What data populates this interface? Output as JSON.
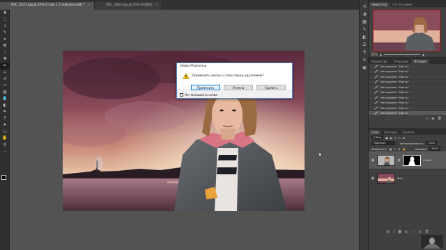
{
  "tabs": [
    {
      "label": "DSC_5227.jpg @ 25% (Слой 1, Слой-маска/8) *",
      "active": true
    },
    {
      "label": "DSC_1853.jpg @ 25% (RGB/8)",
      "active": false
    }
  ],
  "dialog": {
    "title": "Adobe Photoshop",
    "message": "Применить маску к слою перед удалением?",
    "buttons": {
      "apply": "Применить",
      "cancel": "Отмена",
      "delete": "Удалить"
    },
    "checkbox_label": "Не показывать снова"
  },
  "panels": {
    "top_tabs": [
      "Навигатор",
      "Гистограмма"
    ],
    "zoom": "25%",
    "history_tabs": [
      "Корректир.",
      "Операции",
      "История"
    ],
    "history_items": [
      "Инструмент \"Кисть\"",
      "Инструмент \"Кисть\"",
      "Инструмент \"Кисть\"",
      "Инструмент \"Кисть\"",
      "Инструмент \"Кисть\"",
      "Инструмент \"Кисть\"",
      "Инструмент \"Кисть\"",
      "Инструмент \"Кисть\"",
      "Инструмент \"Кисть\"",
      "Инструмент \"Кисть\""
    ],
    "layers_tabs": [
      "Слои",
      "Контуры",
      "Каналы"
    ],
    "kind_label": "Вид",
    "blend_mode": "Обычные",
    "opacity_label": "Непрозрачность:",
    "opacity": "100%",
    "lock_label": "Закрепить:",
    "fill_label": "Заливка:",
    "fill": "100%",
    "layers": [
      {
        "name": "Слой 1",
        "selected": true
      },
      {
        "name": "Фон",
        "selected": false
      }
    ]
  },
  "colors": {
    "accent": "#4a90d8",
    "bg": "#535353",
    "toolbar": "#2f2f2f"
  }
}
